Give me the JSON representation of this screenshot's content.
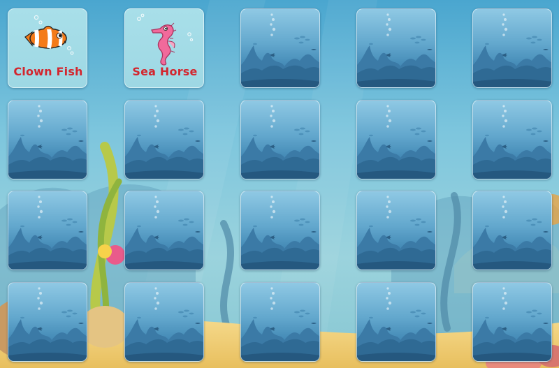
{
  "board": {
    "columns": 5,
    "rows": 4,
    "revealed_cards": [
      {
        "index": 0,
        "label": "Clown Fish",
        "icon": "clownfish-icon"
      },
      {
        "index": 1,
        "label": "Sea Horse",
        "icon": "seahorse-icon"
      }
    ],
    "hidden_card_count": 18
  },
  "colors": {
    "label_text": "#d3262e",
    "card_face_bg": "#a8dfe9",
    "card_back_top": "#8fc9e4",
    "card_back_bottom": "#2d6e9c"
  }
}
